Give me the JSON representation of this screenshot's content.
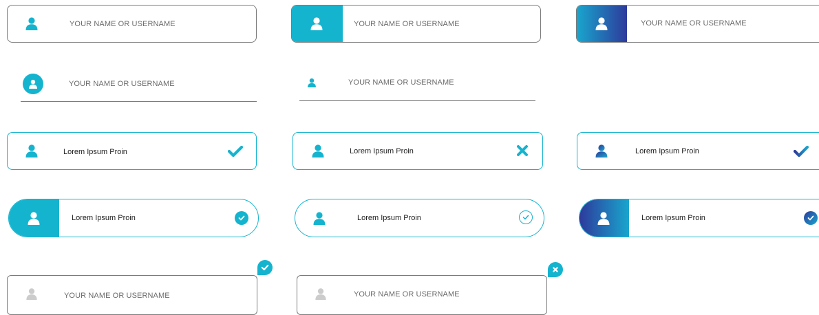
{
  "colors": {
    "accent": "#14b4cf",
    "gradient_start": "#2d3a9c",
    "gradient_end": "#19a6cd",
    "neutral_border": "#7a7a7a",
    "disabled_icon": "#cccccc"
  },
  "icons": {
    "user": "user-icon",
    "check": "check-icon",
    "cross": "close-icon"
  },
  "fields": {
    "f1": {
      "placeholder": "YOUR NAME OR USERNAME"
    },
    "f2": {
      "placeholder": "YOUR NAME OR USERNAME"
    },
    "f3": {
      "placeholder": "YOUR NAME OR USERNAME"
    },
    "f4": {
      "placeholder": "YOUR NAME OR USERNAME"
    },
    "f5": {
      "placeholder": "YOUR NAME OR USERNAME"
    },
    "f6": {
      "value": "Lorem Ipsum Proin"
    },
    "f7": {
      "value": "Lorem Ipsum Proin"
    },
    "f8": {
      "value": "Lorem Ipsum Proin"
    },
    "f9": {
      "value": "Lorem Ipsum Proin"
    },
    "f10": {
      "value": "Lorem Ipsum Proin"
    },
    "f11": {
      "value": "Lorem Ipsum Proin"
    },
    "f12": {
      "placeholder": "YOUR NAME OR USERNAME"
    },
    "f13": {
      "placeholder": "YOUR NAME OR USERNAME"
    }
  }
}
